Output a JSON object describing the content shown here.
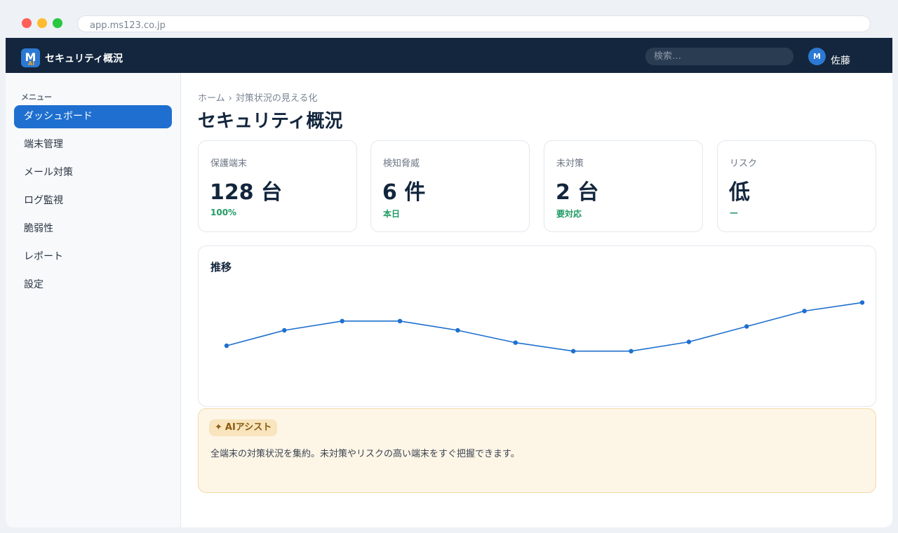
{
  "browser": {
    "url": "app.ms123.co.jp"
  },
  "topbar": {
    "logo_letter": "M",
    "logo_sub": "AI",
    "title": "セキュリティ概況",
    "search_placeholder": "検索…",
    "avatar_initial": "M",
    "user_name": "佐藤"
  },
  "sidebar": {
    "heading": "メニュー",
    "items": [
      {
        "label": "ダッシュボード",
        "active": true
      },
      {
        "label": "端末管理",
        "active": false
      },
      {
        "label": "メール対策",
        "active": false
      },
      {
        "label": "ログ監視",
        "active": false
      },
      {
        "label": "脆弱性",
        "active": false
      },
      {
        "label": "レポート",
        "active": false
      },
      {
        "label": "設定",
        "active": false
      }
    ]
  },
  "main": {
    "breadcrumb": [
      "ホーム",
      "対策状況の見える化"
    ],
    "breadcrumb_sep": "›",
    "title": "セキュリティ概況",
    "cards": [
      {
        "label": "保護端末",
        "value": "128 台",
        "sub": "100%"
      },
      {
        "label": "検知脅威",
        "value": "6 件",
        "sub": "本日"
      },
      {
        "label": "未対策",
        "value": "2 台",
        "sub": "要対応"
      },
      {
        "label": "リスク",
        "value": "低",
        "sub": "—"
      }
    ],
    "chart_title": "推移",
    "ai": {
      "badge_icon": "sparkle-icon",
      "badge_label": "AIアシスト",
      "text": "全端末の対策状況を集約。未対策やリスクの高い端末をすぐ把握できます。"
    }
  },
  "colors": {
    "topbar": "#13263d",
    "accent": "#1e6fcf",
    "positive": "#1f9a63",
    "ai_bg": "#fdf5e6"
  },
  "chart_data": {
    "type": "line",
    "title": "推移",
    "x": [
      1,
      2,
      3,
      4,
      5,
      6,
      7,
      8,
      9,
      10,
      11,
      12
    ],
    "series": [
      {
        "values": [
          40,
          50,
          56,
          56,
          50,
          42,
          36.5,
          36.5,
          42.5,
          52.5,
          62.5,
          68
        ]
      }
    ],
    "ylim": [
      0,
      100
    ],
    "grid": false,
    "color": "#1e6fcf"
  }
}
